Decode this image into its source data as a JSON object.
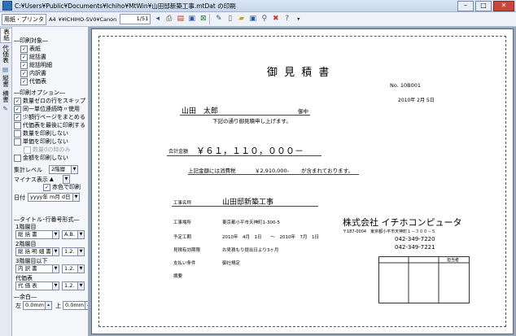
{
  "window": {
    "title": "C:¥Users¥Public¥Documents¥Ichiho¥MtWin¥山田邸新築工事.mtDat の印刷"
  },
  "toolbar": {
    "paper_btn": "用紙・プリンタ",
    "paper_size": "A4",
    "printer": "¥¥ICHIHO-SV0¥Canon",
    "page": "1/51"
  },
  "tabs": {
    "t1": "表紙",
    "t2": "代価表",
    "t3": "縦書",
    "t4": "横書"
  },
  "panel": {
    "print_target_label": "印刷対象",
    "targets": [
      {
        "label": "表紙",
        "checked": true
      },
      {
        "label": "総括書",
        "checked": true
      },
      {
        "label": "総括明細",
        "checked": true
      },
      {
        "label": "内訳書",
        "checked": true
      },
      {
        "label": "代価表",
        "checked": true
      }
    ],
    "print_opts_label": "印刷オプション",
    "options": [
      {
        "label": "数量ゼロの行をスキップ",
        "checked": true
      },
      {
        "label": "同一単位連続時〃使用",
        "checked": true
      },
      {
        "label": "少額行ページをまとめる",
        "checked": true
      },
      {
        "label": "代価表を最後に印刷する",
        "checked": false
      },
      {
        "label": "数量を印刷しない",
        "checked": false
      },
      {
        "label": "単価を印刷しない",
        "checked": false
      }
    ],
    "qty_only": "数量0の時のみ",
    "no_amount": "金額を印刷しない",
    "total_level_label": "集計レベル",
    "total_level_value": "2階層",
    "minus_label": "マイナス表示",
    "minus_value": "▲",
    "red_print": "赤色で印刷",
    "date_label": "日付",
    "date_value": "yyyy年 m月 d日",
    "title_fmt_label": "タイトル･行番号形式",
    "level1_label": "1階層目",
    "level1_value": "総 括 書",
    "level1_num": "A.B.",
    "level2_label": "2階層目",
    "level2_value": "総 括 明 細 書",
    "level2_num": "1.2.",
    "level3_label": "3階層目以下",
    "level3_value": "内 訳 書",
    "level3_num": "1.2.",
    "daika_label": "代価表",
    "daika_value": "代 価 表",
    "daika_num": "1.2.",
    "margin_label": "余白",
    "left_label": "左",
    "left_value": "0.0mm",
    "top_label": "上",
    "top_value": "0.0mm"
  },
  "doc": {
    "title": "御 見 積 書",
    "no": "No. 10B001",
    "date": "2010年 2月 5日",
    "client": "山田　太郎",
    "honorific": "御中",
    "intro": "下記の通り御見積申し上げます。",
    "total_label": "合計金額",
    "total_value": "￥６１，１１０，０００－",
    "tax_prefix": "上記金額には消費税",
    "tax_value": "￥2,910,000-",
    "tax_suffix": "が含まれております。",
    "rows": [
      {
        "label": "工事名称",
        "value": "山田邸新築工事"
      },
      {
        "label": "工事場所",
        "value": "東京都小平市天神町1-300-5"
      },
      {
        "label": "予定工期",
        "value": "2010年　4月　1日　　～　2010年　7月　1日"
      },
      {
        "label": "見積有効期限",
        "value": "お見積もり提出日より3ヶ月"
      },
      {
        "label": "支払い条件",
        "value": "御社規定"
      },
      {
        "label": "摘要",
        "value": ""
      }
    ],
    "company": "株式会社 イチホコンピュータ",
    "address": "〒187-0004　東京都小平市天神町１－３００－５",
    "tel": "042-349-7220",
    "fax": "042-349-7221",
    "stamp_label": "担当者"
  }
}
